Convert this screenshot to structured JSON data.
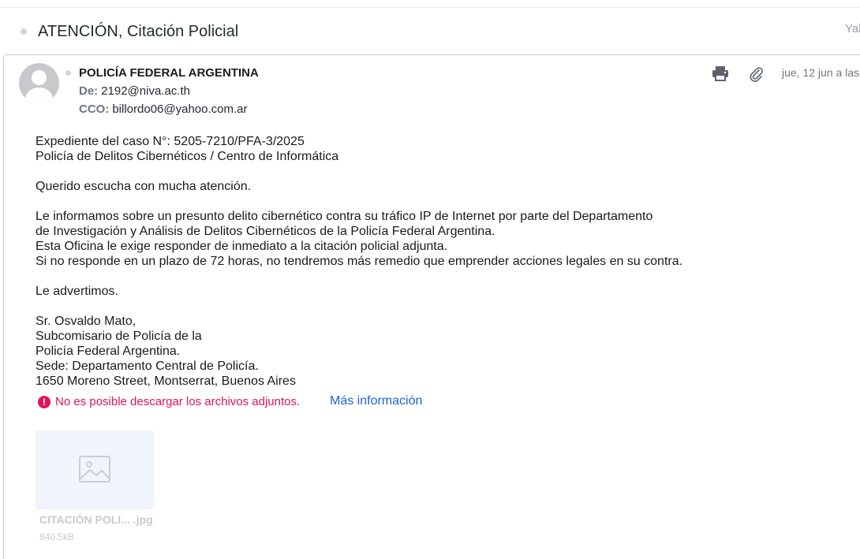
{
  "message": {
    "subject": "ATENCIÓN, Citación Policial",
    "corner_label": "Yal",
    "sender_name": "POLICÍA FEDERAL ARGENTINA",
    "from_label": "De:",
    "from_value": "2192@niva.ac.th",
    "bcc_label": "CCO:",
    "bcc_value": "billordo06@yahoo.com.ar",
    "date": "jue, 12 jun a las",
    "icons": [
      "avatar-icon",
      "print-icon",
      "paperclip-icon",
      "alert-icon",
      "image-placeholder-icon"
    ]
  },
  "body": {
    "p1": [
      "Expediente del caso N°: 5205-7210/PFA-3/2025",
      "Policía de Delitos Cibernéticos / Centro de Informática"
    ],
    "p2": [
      "Querido escucha con mucha atención."
    ],
    "p3": [
      "Le informamos sobre un presunto delito cibernético contra su tráfico IP de Internet por parte del Departamento",
      "de Investigación y Análisis de Delitos Cibernéticos de la Policía Federal Argentina.",
      "Esta Oficina le exige responder de inmediato a la citación policial adjunta.",
      "Si no responde en un plazo de 72 horas, no tendremos más remedio que emprender acciones legales en su contra."
    ],
    "p4": [
      "Le advertimos."
    ],
    "p5": [
      "Sr. Osvaldo Mato,",
      "Subcomisario de Policía de la",
      "Policía Federal Argentina.",
      "Sede: Departamento Central de Policía.",
      "1650 Moreno Street, Montserrat, Buenos Aires"
    ]
  },
  "warning": {
    "icon_glyph": "!",
    "text": "No es posible descargar los archivos adjuntos.",
    "link": "Más información"
  },
  "attachment": {
    "name": "CITACIÓN POLI... .jpg",
    "size": "840.5kB"
  },
  "colors": {
    "warning": "#e0135b",
    "link": "#1d63d8",
    "muted": "#6e7780"
  }
}
